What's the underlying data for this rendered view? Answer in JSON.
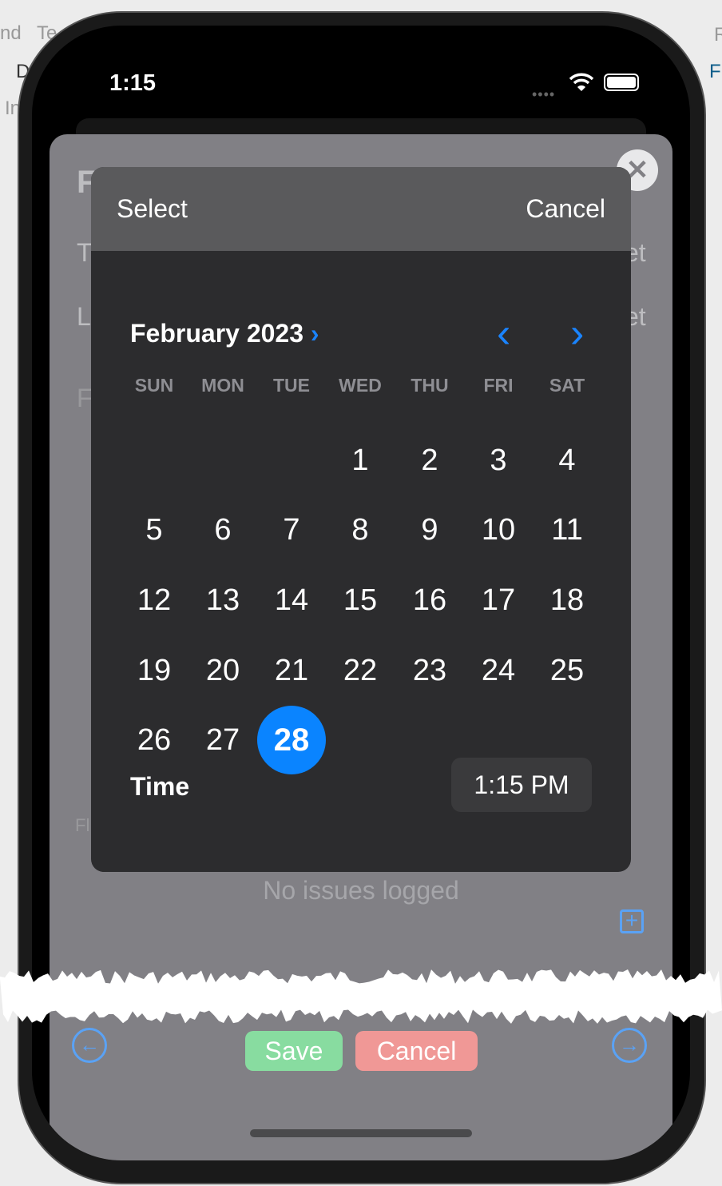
{
  "background_fragments": {
    "left_top": "nd",
    "left_top2": "Te",
    "left2": "D",
    "left3": "In",
    "right_top": "R",
    "right2": "F"
  },
  "status_bar": {
    "time": "1:15"
  },
  "sheet_fragments": {
    "title": "F",
    "row1": "T",
    "row2": "L",
    "row3": "F",
    "row4": "Fl",
    "row1_right": "et",
    "row2_right": "et"
  },
  "picker": {
    "select_label": "Select",
    "cancel_label": "Cancel",
    "month_title": "February 2023",
    "weekdays": [
      "SUN",
      "MON",
      "TUE",
      "WED",
      "THU",
      "FRI",
      "SAT"
    ],
    "first_weekday_index": 3,
    "days": [
      "1",
      "2",
      "3",
      "4",
      "5",
      "6",
      "7",
      "8",
      "9",
      "10",
      "11",
      "12",
      "13",
      "14",
      "15",
      "16",
      "17",
      "18",
      "19",
      "20",
      "21",
      "22",
      "23",
      "24",
      "25",
      "26",
      "27",
      "28"
    ],
    "selected_day": "28",
    "time_label": "Time",
    "time_value": "1:15 PM",
    "accent": "#0a84ff"
  },
  "main": {
    "empty_text": "No issues logged",
    "save_label": "Save",
    "cancel_label": "Cancel"
  }
}
